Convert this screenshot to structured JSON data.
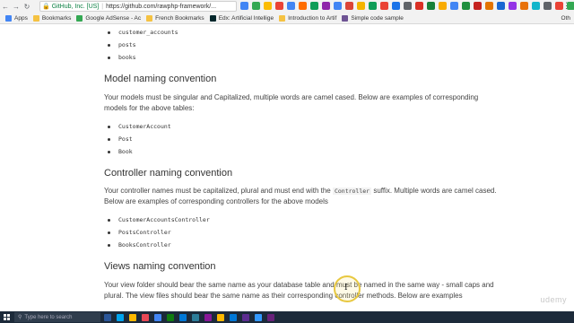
{
  "browser": {
    "secure_name": "GitHub, Inc. [US]",
    "url": "https://github.com/rawphp-framework/...",
    "bookmarks": [
      {
        "label": "Apps",
        "color": "#4285f4"
      },
      {
        "label": "Bookmarks",
        "color": "#f5c242"
      },
      {
        "label": "Google AdSense - Ac",
        "color": "#34a853"
      },
      {
        "label": "French Bookmarks",
        "color": "#f5c242"
      },
      {
        "label": "Edx: Artificial Intellige",
        "color": "#02262b"
      },
      {
        "label": "Introduction to Artif",
        "color": "#f5c242"
      },
      {
        "label": "Simple code sample",
        "color": "#6e5494"
      }
    ],
    "other_bookmarks": "Oth",
    "extension_colors": [
      "#4285f4",
      "#34a853",
      "#fbbc05",
      "#ea4335",
      "#4285f4",
      "#ff6d00",
      "#0f9d58",
      "#8e24aa",
      "#4285f4",
      "#db4437",
      "#f4b400",
      "#0f9d58",
      "#ea4335",
      "#1a73e8",
      "#5f6368",
      "#d93025",
      "#188038",
      "#f9ab00",
      "#4285f4",
      "#1e8e3e",
      "#c5221f",
      "#e37400",
      "#1967d2",
      "#9334e6",
      "#e8710a",
      "#12b5cb",
      "#5f6368",
      "#ea4335",
      "#34a853",
      "#fbbc05"
    ]
  },
  "content": {
    "top_list": [
      "customer_accounts",
      "posts",
      "books"
    ],
    "model_heading": "Model naming convention",
    "model_para": "Your models must be singular and Capitalized, multiple words are camel cased. Below are examples of corresponding models for the above tables:",
    "model_list": [
      "CustomerAccount",
      "Post",
      "Book"
    ],
    "controller_heading": "Controller naming convention",
    "controller_para_before": "Your controller names must be capitalized, plural and must end with the ",
    "controller_code": "Controller",
    "controller_para_after": " suffix. Multiple words are camel cased. Below are examples of corresponding controllers for the above models",
    "controller_list": [
      "CustomerAccountsController",
      "PostsController",
      "BooksController"
    ],
    "views_heading": "Views naming convention",
    "views_para": "Your view folder should bear the same name as your database table and must be named in the same way - small caps and plural. The view files should bear the same name as their corresponding controller methods. Below are examples",
    "watermark": "udemy"
  },
  "taskbar": {
    "search_placeholder": "Type here to search",
    "icon_colors": [
      "#2b579a",
      "#00a4ef",
      "#ffb900",
      "#e74856",
      "#4285f4",
      "#107c10",
      "#0078d7",
      "#2d7d9a",
      "#881798",
      "#ffb900",
      "#0078d7",
      "#5c2d91",
      "#3399ff",
      "#68217a"
    ]
  }
}
